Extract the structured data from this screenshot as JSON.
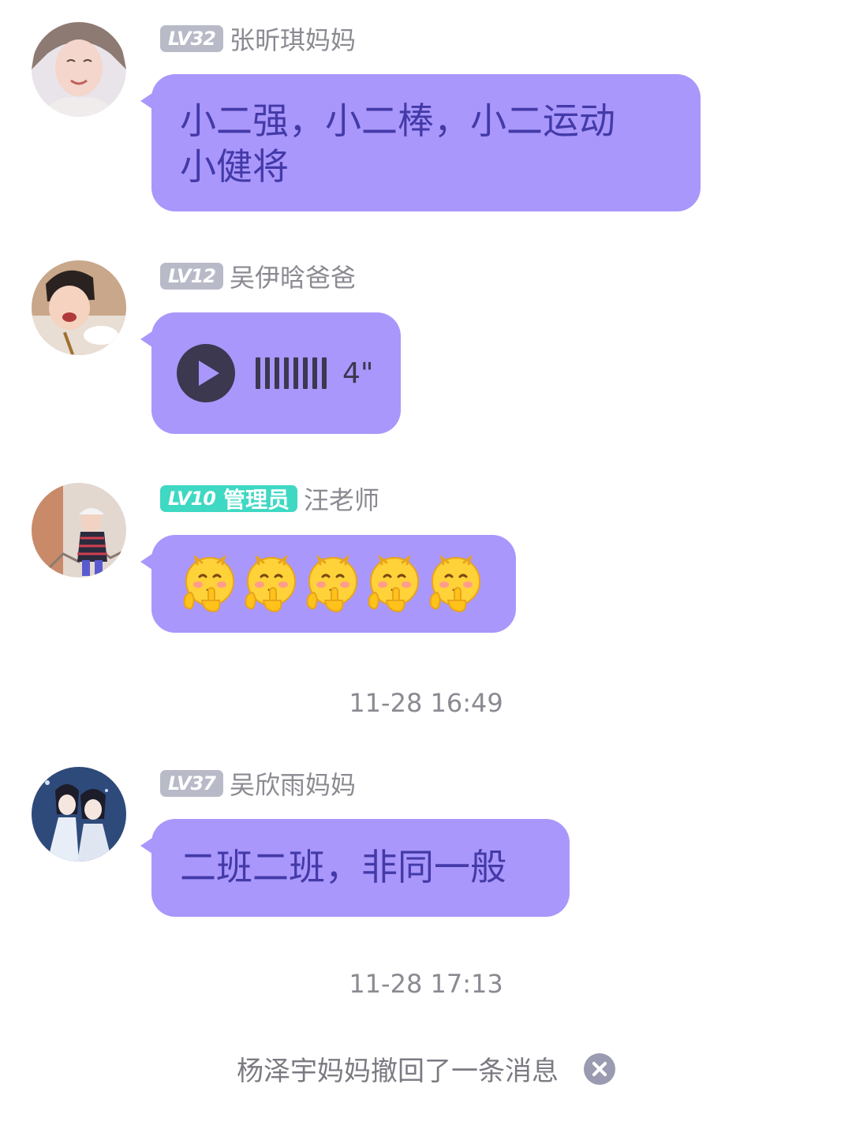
{
  "messages": [
    {
      "avatar": "woman-portrait-avatar",
      "level": "LV32",
      "sender": "张昕琪妈妈",
      "text_line1": "小二强，小二棒，小二运动",
      "text_line2": "小健将"
    },
    {
      "avatar": "child-eating-avatar",
      "level": "LV12",
      "sender": "吴伊晗爸爸",
      "voice_duration": "4\""
    },
    {
      "avatar": "girl-on-stairs-avatar",
      "level": "LV10",
      "role": "管理员",
      "sender": "汪老师",
      "emoji_icon": "shush-face-emoji",
      "emoji_count": 5
    },
    {
      "avatar": "illustration-two-figures-avatar",
      "level": "LV37",
      "sender": "吴欣雨妈妈",
      "text": "二班二班，非同一般"
    }
  ],
  "timestamps": [
    "11-28 16:49",
    "11-28 17:13"
  ],
  "recall_notice": "杨泽宇妈妈撤回了一条消息",
  "colors": {
    "bubble": "#aa97fb",
    "bubble_text": "#433aa8",
    "level_badge": "#b8bac8",
    "admin_badge": "#3ed8c3"
  }
}
